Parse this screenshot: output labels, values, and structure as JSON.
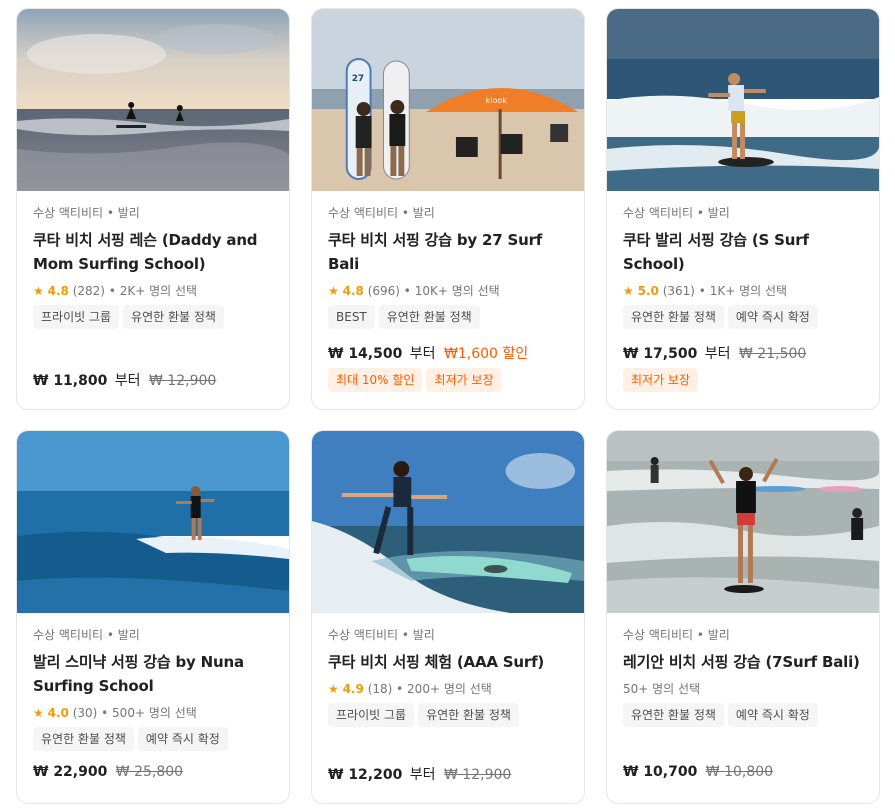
{
  "cards": [
    {
      "category": "수상 액티비티 • 발리",
      "title": "쿠타 비치 서핑 레슨 (Daddy and Mom Surfing School)",
      "rating": {
        "score": "4.8",
        "reviews": "(282)",
        "booked": "• 2K+ 명의 선택"
      },
      "tags": [
        "프라이빗 그룹",
        "유연한 환불 정책"
      ],
      "price": "₩ 11,800",
      "from": "부터",
      "old_price": "₩ 12,900",
      "discount": "",
      "promos": []
    },
    {
      "category": "수상 액티비티 • 발리",
      "title": "쿠타 비치 서핑 강습 by 27 Surf Bali",
      "rating": {
        "score": "4.8",
        "reviews": "(696)",
        "booked": "• 10K+ 명의 선택"
      },
      "tags": [
        "BEST",
        "유연한 환불 정책"
      ],
      "price": "₩ 14,500",
      "from": "부터",
      "old_price": "",
      "discount": "₩1,600 할인",
      "promos": [
        "최대 10% 할인",
        "최저가 보장"
      ]
    },
    {
      "category": "수상 액티비티 • 발리",
      "title": "쿠타 발리 서핑 강습 (S Surf School)",
      "rating": {
        "score": "5.0",
        "reviews": "(361)",
        "booked": "• 1K+ 명의 선택"
      },
      "tags": [
        "유연한 환불 정책",
        "예약 즉시 확정"
      ],
      "price": "₩ 17,500",
      "from": "부터",
      "old_price": "₩ 21,500",
      "discount": "",
      "promos": [
        "최저가 보장"
      ]
    },
    {
      "category": "수상 액티비티 • 발리",
      "title": "발리 스미냑 서핑 강습 by Nuna Surfing School",
      "rating": {
        "score": "4.0",
        "reviews": "(30)",
        "booked": "• 500+ 명의 선택"
      },
      "tags": [
        "유연한 환불 정책",
        "예약 즉시 확정"
      ],
      "price": "₩ 22,900",
      "from": "",
      "old_price": "₩ 25,800",
      "discount": "",
      "promos": []
    },
    {
      "category": "수상 액티비티 • 발리",
      "title": "쿠타 비치 서핑 체험 (AAA Surf)",
      "rating": {
        "score": "4.9",
        "reviews": "(18)",
        "booked": "• 200+ 명의 선택"
      },
      "tags": [
        "프라이빗 그룹",
        "유연한 환불 정책"
      ],
      "price": "₩ 12,200",
      "from": "부터",
      "old_price": "₩ 12,900",
      "discount": "",
      "promos": []
    },
    {
      "category": "수상 액티비티 • 발리",
      "title": "레기안 비치 서핑 강습 (7Surf Bali)",
      "rating": {
        "score": "",
        "reviews": "",
        "booked": "50+ 명의 선택"
      },
      "tags": [
        "유연한 환불 정책",
        "예약 즉시 확정"
      ],
      "price": "₩ 10,700",
      "from": "",
      "old_price": "₩ 10,800",
      "discount": "",
      "promos": []
    }
  ],
  "star_glyph": "★",
  "umbrella_logo": "klook",
  "board_number": "27",
  "colors": {
    "accent": "#ff5b00",
    "star": "#f09b0a",
    "promo_bg": "#fff0e5"
  }
}
